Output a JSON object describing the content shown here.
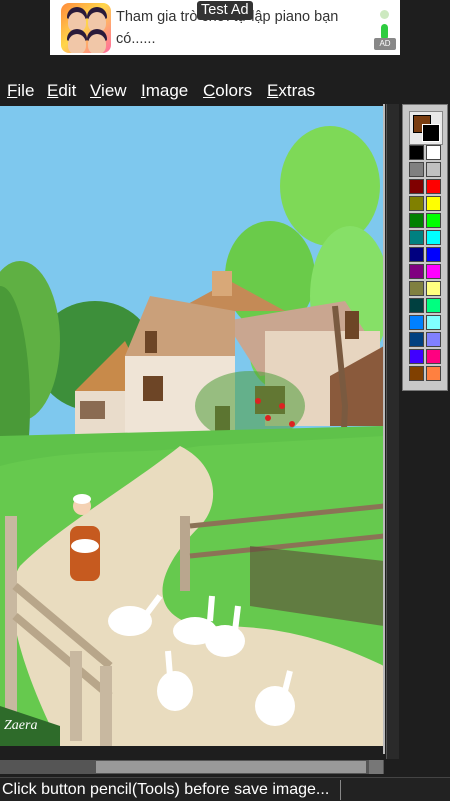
{
  "ad": {
    "text": "Tham gia trò chơi tự lập piano bạn có......",
    "badge": "Test Ad",
    "ad_icon": "AD"
  },
  "menu": [
    {
      "label": "File"
    },
    {
      "label": "Edit"
    },
    {
      "label": "View"
    },
    {
      "label": "Image"
    },
    {
      "label": "Colors"
    },
    {
      "label": "Extras"
    }
  ],
  "canvas": {
    "signature": "Zaera",
    "image_desc_icon": "painting-icon"
  },
  "palette": {
    "foreground": "#7a3d10",
    "background": "#000000",
    "colors": [
      [
        "#000000",
        "#ffffff"
      ],
      [
        "#808080",
        "#c0c0c0"
      ],
      [
        "#800000",
        "#ff0000"
      ],
      [
        "#808000",
        "#ffff00"
      ],
      [
        "#008000",
        "#00ff00"
      ],
      [
        "#008080",
        "#00ffff"
      ],
      [
        "#000080",
        "#0000ff"
      ],
      [
        "#800080",
        "#ff00ff"
      ],
      [
        "#808040",
        "#ffff80"
      ],
      [
        "#004040",
        "#00ff80"
      ],
      [
        "#0080ff",
        "#80ffff"
      ],
      [
        "#004080",
        "#8080ff"
      ],
      [
        "#4000ff",
        "#ff0080"
      ],
      [
        "#804000",
        "#ff8040"
      ]
    ]
  },
  "status": {
    "message": "Click button pencil(Tools) before save image..."
  }
}
